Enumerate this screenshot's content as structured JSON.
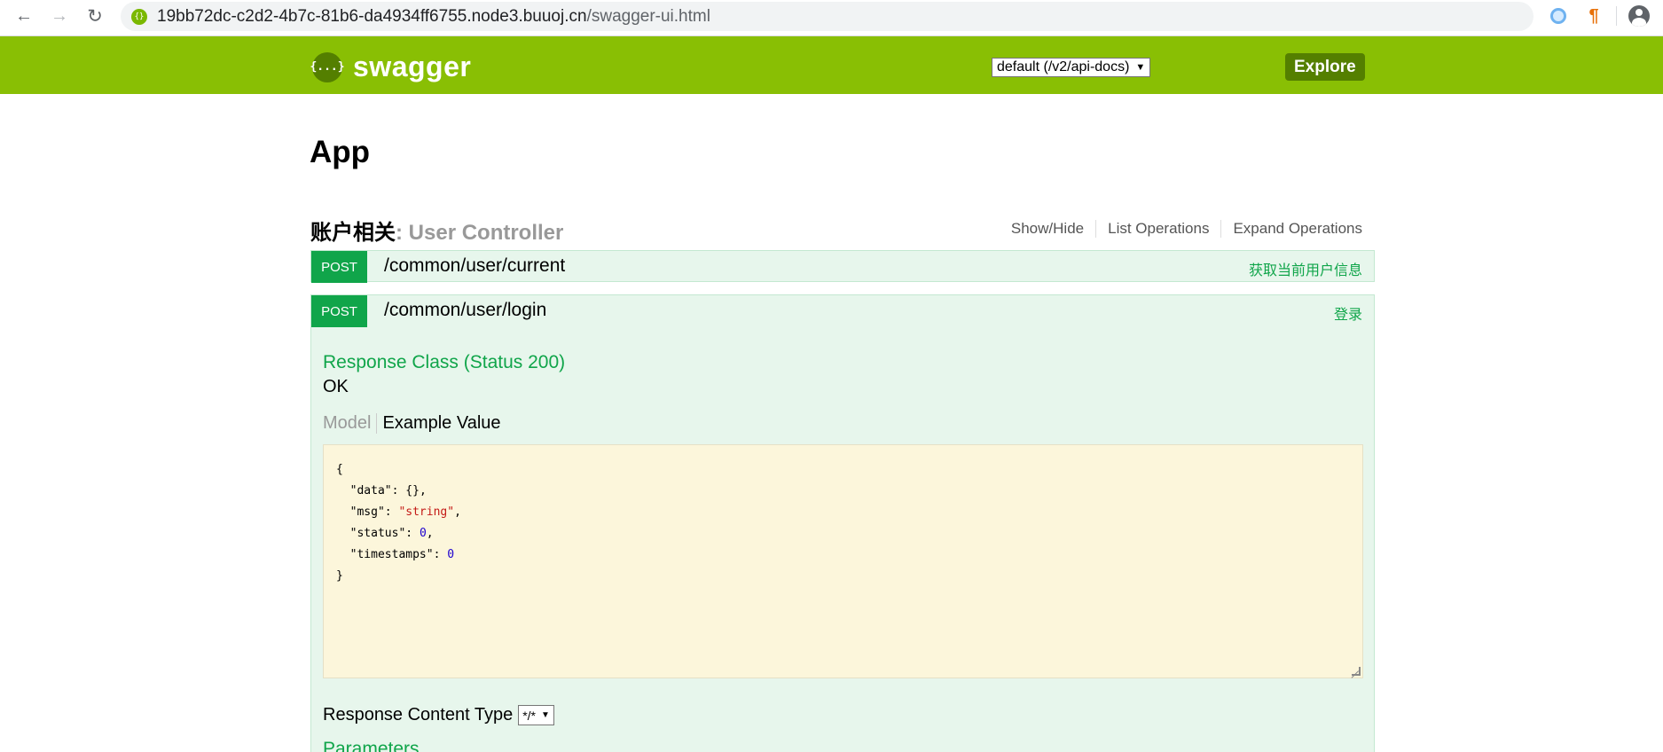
{
  "browser": {
    "url_host": "19bb72dc-c2d2-4b7c-81b6-da4934ff6755.node3.buuoj.cn",
    "url_path": "/swagger-ui.html"
  },
  "header": {
    "logo_text": "swagger",
    "logo_mark": "{...}",
    "spec_select": "default (/v2/api-docs)",
    "explore_label": "Explore",
    "bg_color": "#89bf04"
  },
  "main": {
    "app_title": "App",
    "section": {
      "title": "账户相关",
      "subtitle": ": User Controller",
      "links": [
        "Show/Hide",
        "List Operations",
        "Expand Operations"
      ]
    },
    "operations": [
      {
        "method": "POST",
        "path": "/common/user/current",
        "summary": "获取当前用户信息"
      },
      {
        "method": "POST",
        "path": "/common/user/login",
        "summary": "登录",
        "response_class_title": "Response Class (Status 200)",
        "response_status_text": "OK",
        "model_tab": "Model",
        "example_tab": "Example Value",
        "example_json": {
          "open": "{",
          "data_key": "\"data\"",
          "data_val": "{}",
          "msg_key": "\"msg\"",
          "msg_val": "\"string\"",
          "status_key": "\"status\"",
          "status_val": "0",
          "timestamps_key": "\"timestamps\"",
          "timestamps_val": "0",
          "close": "}"
        },
        "response_content_type_label": "Response Content Type",
        "response_content_type_value": "*/*",
        "parameters_title": "Parameters"
      }
    ]
  },
  "colors": {
    "method_post": "#10a54a",
    "op_bg": "#e7f6ec",
    "example_bg": "#fcf6db"
  }
}
